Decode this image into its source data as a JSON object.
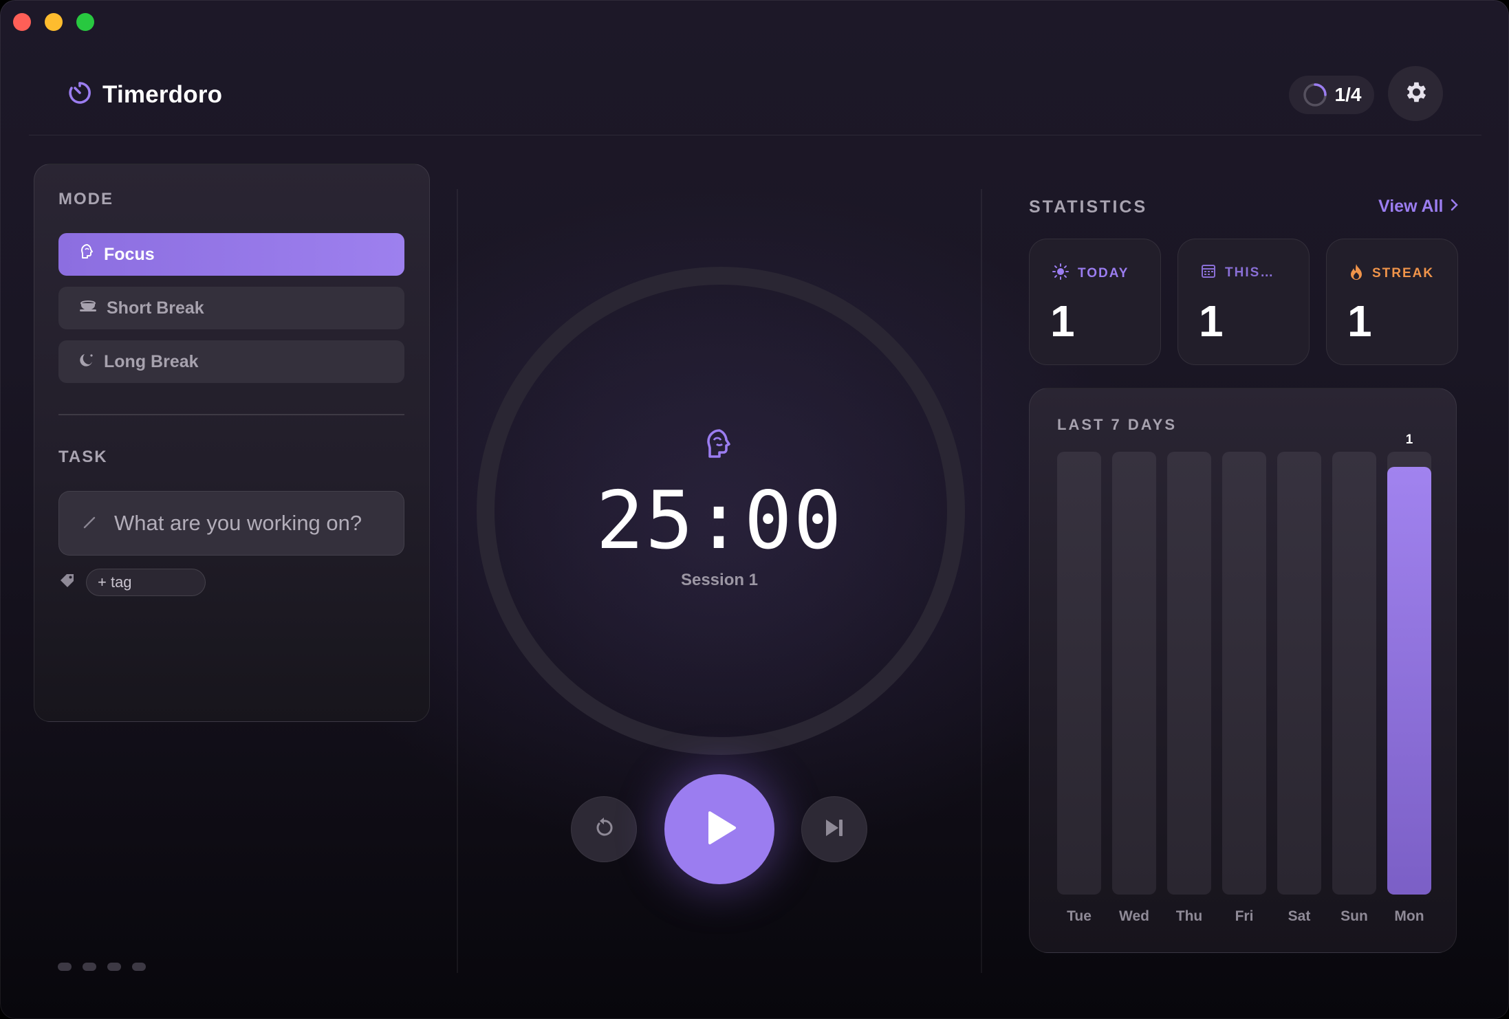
{
  "app": {
    "title": "Timerdoro",
    "cycle": "1/4",
    "cycle_progress": 0.25
  },
  "mode": {
    "label": "MODE",
    "items": [
      {
        "label": "Focus",
        "icon": "brain-icon",
        "active": true
      },
      {
        "label": "Short Break",
        "icon": "coffee-cup-icon",
        "active": false
      },
      {
        "label": "Long Break",
        "icon": "moon-icon",
        "active": false
      }
    ]
  },
  "task": {
    "label": "TASK",
    "placeholder": "What are you working on?",
    "tag_button": "+ tag"
  },
  "timer": {
    "time": "25:00",
    "session": "Session 1",
    "progress": 0
  },
  "stats": {
    "title": "STATISTICS",
    "view_all": "View All",
    "cards": [
      {
        "label": "TODAY",
        "value": "1",
        "icon": "sun-icon",
        "color": "#9b7df0"
      },
      {
        "label": "THIS…",
        "value": "1",
        "icon": "calendar-icon",
        "color": "#8a6fd6"
      },
      {
        "label": "STREAK",
        "value": "1",
        "icon": "flame-icon",
        "color": "#f0944a"
      }
    ]
  },
  "chart_data": {
    "type": "bar",
    "title": "LAST 7 DAYS",
    "categories": [
      "Tue",
      "Wed",
      "Thu",
      "Fri",
      "Sat",
      "Sun",
      "Mon"
    ],
    "values": [
      0,
      0,
      0,
      0,
      0,
      0,
      1
    ],
    "data_labels": [
      "",
      "",
      "",
      "",
      "",
      "",
      "1"
    ],
    "ylim": [
      0,
      1
    ],
    "grid": false
  },
  "colors": {
    "accent": "#9b7df0",
    "background": "#1a1624",
    "streak": "#f0944a"
  }
}
